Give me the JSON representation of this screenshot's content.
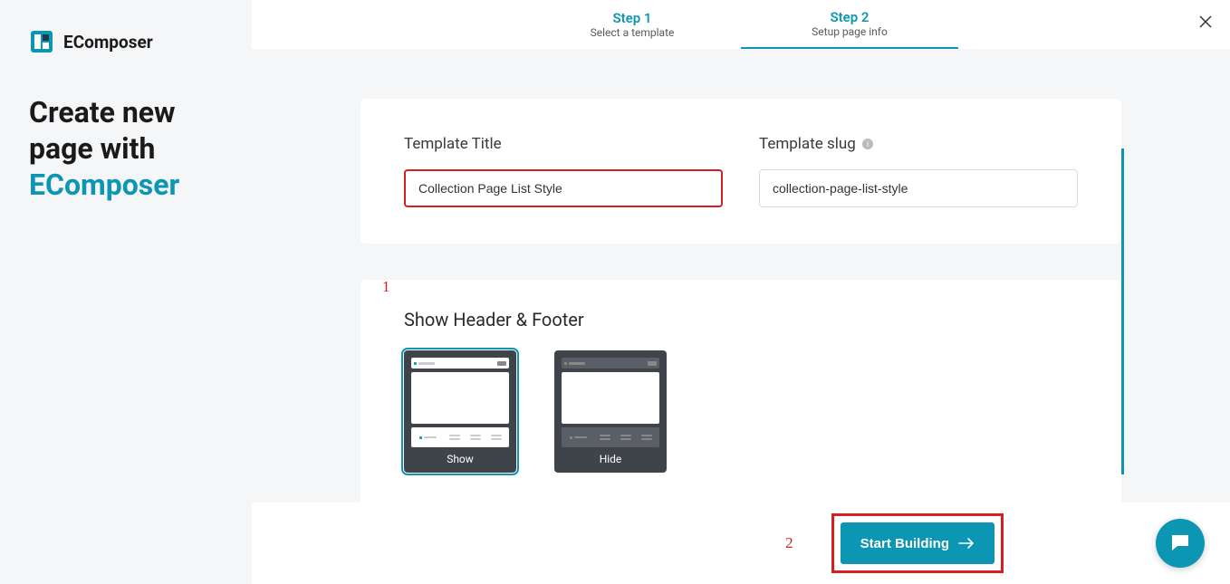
{
  "sidebar": {
    "logo_text": "EComposer",
    "title_line1": "Create new",
    "title_line2": "page with",
    "title_line3": "EComposer"
  },
  "steps": [
    {
      "title": "Step 1",
      "sub": "Select a template"
    },
    {
      "title": "Step 2",
      "sub": "Setup page info"
    }
  ],
  "form": {
    "title_label": "Template Title",
    "title_value": "Collection Page List Style",
    "slug_label": "Template slug",
    "slug_value": "collection-page-list-style"
  },
  "showhf": {
    "section_title": "Show Header & Footer",
    "option_show": "Show",
    "option_hide": "Hide"
  },
  "footer": {
    "start_label": "Start Building"
  },
  "annotations": {
    "one": "1",
    "two": "2"
  }
}
